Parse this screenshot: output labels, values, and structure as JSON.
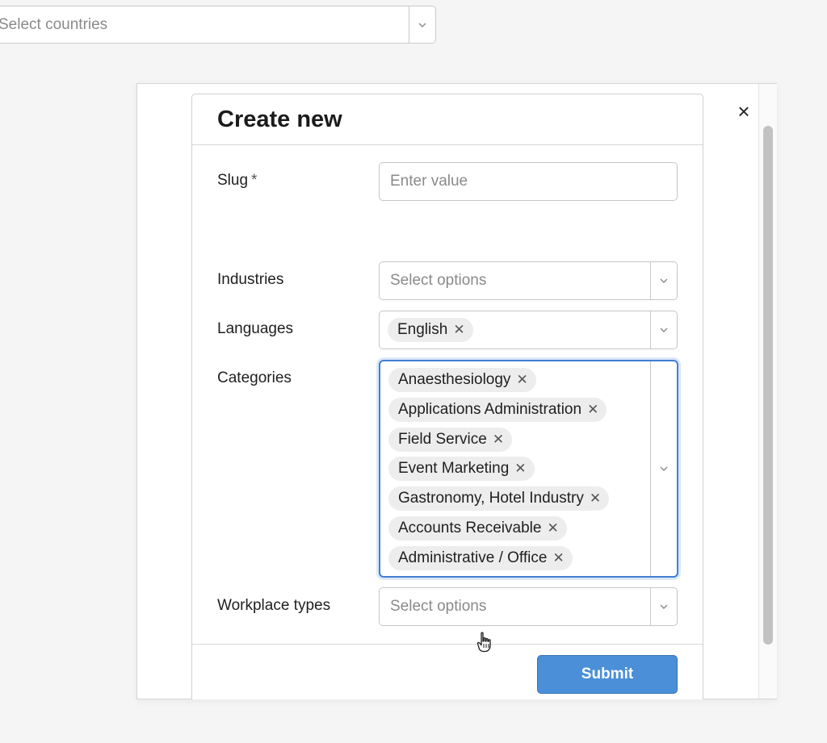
{
  "country_select": {
    "placeholder": "Select countries"
  },
  "modal": {
    "title": "Create new",
    "close_icon": "×",
    "fields": {
      "slug": {
        "label": "Slug",
        "required_mark": "*",
        "placeholder": "Enter value"
      },
      "industries": {
        "label": "Industries",
        "placeholder": "Select options"
      },
      "languages": {
        "label": "Languages",
        "selected": [
          "English"
        ]
      },
      "categories": {
        "label": "Categories",
        "selected": [
          "Anaesthesiology",
          "Applications Administration",
          "Field Service",
          "Event Marketing",
          "Gastronomy, Hotel Industry",
          "Accounts Receivable",
          "Administrative / Office"
        ]
      },
      "workplace_types": {
        "label": "Workplace types",
        "placeholder": "Select options"
      }
    },
    "submit_label": "Submit"
  },
  "icons": {
    "chevron": "chevron-down-icon",
    "remove": "x-icon",
    "close": "close-icon",
    "cursor": "hand-pointer-icon"
  },
  "colors": {
    "primary": "#4a8fd8",
    "focus_border": "#3f7fd5",
    "chip_bg": "#ededed"
  },
  "chip_remove_glyph": "✕",
  "chevron_glyph": "⌄"
}
